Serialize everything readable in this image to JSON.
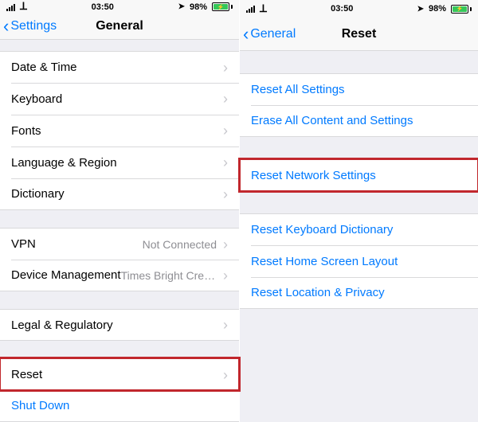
{
  "status": {
    "time": "03:50",
    "battery_pct": "98%"
  },
  "left": {
    "back": "Settings",
    "title": "General",
    "rows": {
      "date_time": "Date & Time",
      "keyboard": "Keyboard",
      "fonts": "Fonts",
      "lang_region": "Language & Region",
      "dictionary": "Dictionary",
      "vpn": "VPN",
      "vpn_detail": "Not Connected",
      "device_mgmt": "Device Management",
      "device_mgmt_detail": "Times Bright CreSu…",
      "legal": "Legal & Regulatory",
      "reset": "Reset",
      "shutdown": "Shut Down"
    }
  },
  "right": {
    "back": "General",
    "title": "Reset",
    "rows": {
      "reset_all": "Reset All Settings",
      "erase_all": "Erase All Content and Settings",
      "reset_network": "Reset Network Settings",
      "reset_keyboard": "Reset Keyboard Dictionary",
      "reset_home": "Reset Home Screen Layout",
      "reset_location": "Reset Location & Privacy"
    }
  }
}
